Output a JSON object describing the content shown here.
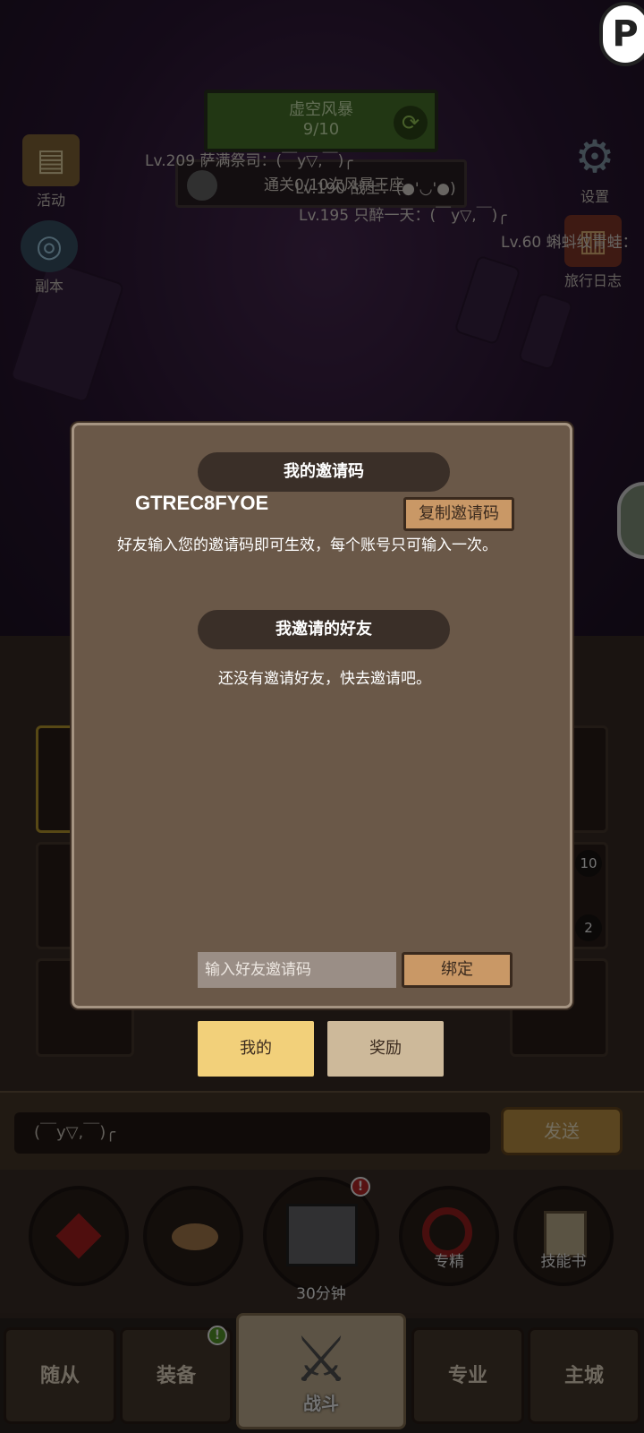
{
  "top_logo_icon": "p-logo-icon",
  "boss": {
    "name": "虚空风暴",
    "progress": "9/10",
    "refresh_icon": "refresh-icon",
    "clear_text": "通关0/10次风暴王座"
  },
  "left_menu": [
    {
      "label": "活动",
      "icon": "scroll-icon"
    },
    {
      "label": "副本",
      "icon": "portal-icon"
    }
  ],
  "right_menu": [
    {
      "label": "设置",
      "icon": "gear-icon"
    },
    {
      "label": "旅行日志",
      "icon": "book-icon"
    }
  ],
  "world_chat": [
    "Lv.209 萨满祭司：(￣y▽,￣)╭",
    "Lv.195 只醉一天：(￣y▽,￣)╭",
    "Lv.60 蝌蚪纹青蛙：",
    "Lv.190 战士：(●'◡'●)"
  ],
  "dialog": {
    "my_code_title": "我的邀请码",
    "code": "GTREC8FYOE",
    "copy_button": "复制邀请码",
    "info": "好友输入您的邀请码即可生效，每个账号只可输入一次。",
    "friends_title": "我邀请的好友",
    "empty_text": "还没有邀请好友，快去邀请吧。",
    "input_placeholder": "输入好友邀请码",
    "bind_button": "绑定"
  },
  "tabs": [
    {
      "label": "我的",
      "active": true
    },
    {
      "label": "奖励",
      "active": false
    }
  ],
  "grid_numbers": [
    "10",
    "2"
  ],
  "chat": {
    "input_value": "(￣y▽,￣)╭",
    "send": "发送"
  },
  "skills": [
    {
      "label": "",
      "icon": "potion-icon"
    },
    {
      "label": "",
      "icon": "bread-icon"
    },
    {
      "label": "30分钟",
      "icon": "chest-icon",
      "badge": "!"
    },
    {
      "label": "专精",
      "icon": "target-icon"
    },
    {
      "label": "技能书",
      "icon": "skill-book-icon"
    }
  ],
  "nav": [
    {
      "label": "随从"
    },
    {
      "label": "装备",
      "badge": "!"
    },
    {
      "label": "战斗",
      "active": true
    },
    {
      "label": "专业"
    },
    {
      "label": "主城"
    }
  ],
  "colors": {
    "dialog_bg": "#6a5848",
    "tab_active": "#f2d07a",
    "tab_inactive": "#cdb99a",
    "wood_button": "#c99866"
  }
}
